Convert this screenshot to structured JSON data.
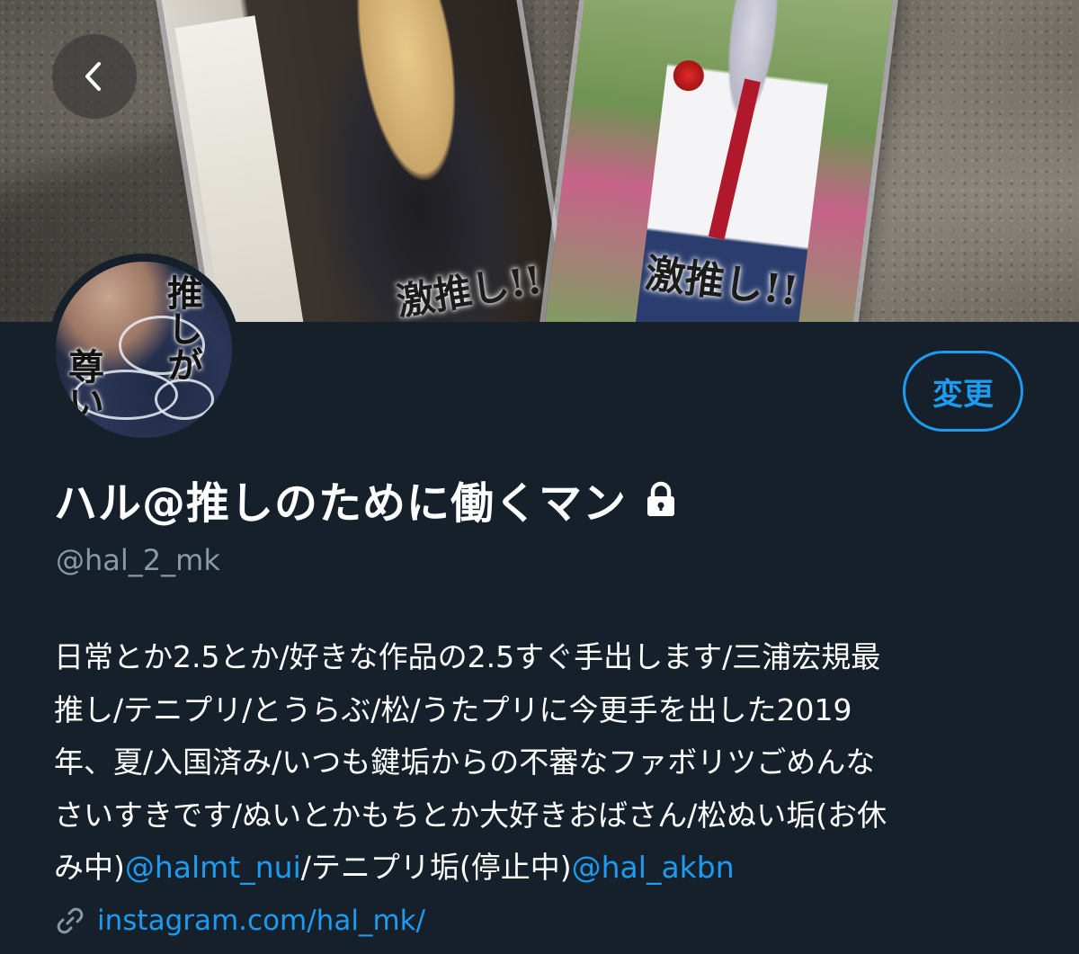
{
  "header": {
    "card_left_caption": "激推し!!",
    "card_right_caption": "激推し!!"
  },
  "avatar": {
    "caption_col1": "推しが",
    "caption_col2": "尊い"
  },
  "profile": {
    "edit_label": "変更",
    "display_name": "ハル@推しのために働くマン",
    "protected_icon": "lock-icon",
    "handle": "@hal_2_mk",
    "bio_line1": "日常とか2.5とか/好きな作品の2.5すぐ手出します/三浦宏規最",
    "bio_line2": "推し/テニプリ/とうらぶ/松/うたプリに今更手を出した2019",
    "bio_line3": "年、夏/入国済み/いつも鍵垢からの不審なファボリツごめんな",
    "bio_line4": "さいすきです/ぬいとかもちとか大好きおばさん/松ぬい垢(お休",
    "bio_line5_prefix": "み中)",
    "bio_mention1": "@halmt_nui",
    "bio_line5_middle": "/テニプリ垢(停止中)",
    "bio_mention2": "@hal_akbn",
    "link_icon": "link-icon",
    "website": "instagram.com/hal_mk/"
  },
  "colors": {
    "background": "#15202b",
    "accent": "#1d9bf0",
    "secondary_text": "#8b98a5"
  }
}
